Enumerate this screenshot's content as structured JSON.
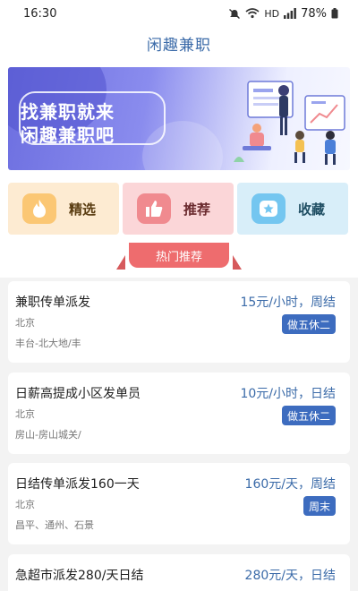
{
  "status": {
    "time": "16:30",
    "hd": "HD",
    "battery": "78%",
    "icons": [
      "mute-icon",
      "wifi-icon",
      "signal-icon",
      "battery-icon"
    ]
  },
  "app": {
    "title": "闲趣兼职"
  },
  "banner": {
    "line1": "找兼职就来",
    "line2": "闲趣兼职吧"
  },
  "quick": [
    {
      "label": "精选",
      "icon": "flame-icon"
    },
    {
      "label": "推荐",
      "icon": "thumbs-up-icon"
    },
    {
      "label": "收藏",
      "icon": "star-icon"
    }
  ],
  "section": {
    "hot_label": "热门推荐"
  },
  "jobs": [
    {
      "title": "兼职传单派发",
      "city": "北京",
      "area": "丰台-北大地/丰",
      "pay": "15元/小时，周结",
      "tag": "做五休二"
    },
    {
      "title": "日薪高提成小区发单员",
      "city": "北京",
      "area": "房山-房山城关/",
      "pay": "10元/小时，日结",
      "tag": "做五休二"
    },
    {
      "title": "日结传单派发160一天",
      "city": "北京",
      "area": "昌平、通州、石景",
      "pay": "160元/天，周结",
      "tag": "周末"
    },
    {
      "title": "急超市派发280/天日结",
      "pay": "280元/天，日结"
    }
  ],
  "colors": {
    "accent": "#3a6aa8",
    "tag_bg": "#3d6cbf",
    "hot_red": "#ee6c6e",
    "banner_purple": "#6d6fe0"
  }
}
